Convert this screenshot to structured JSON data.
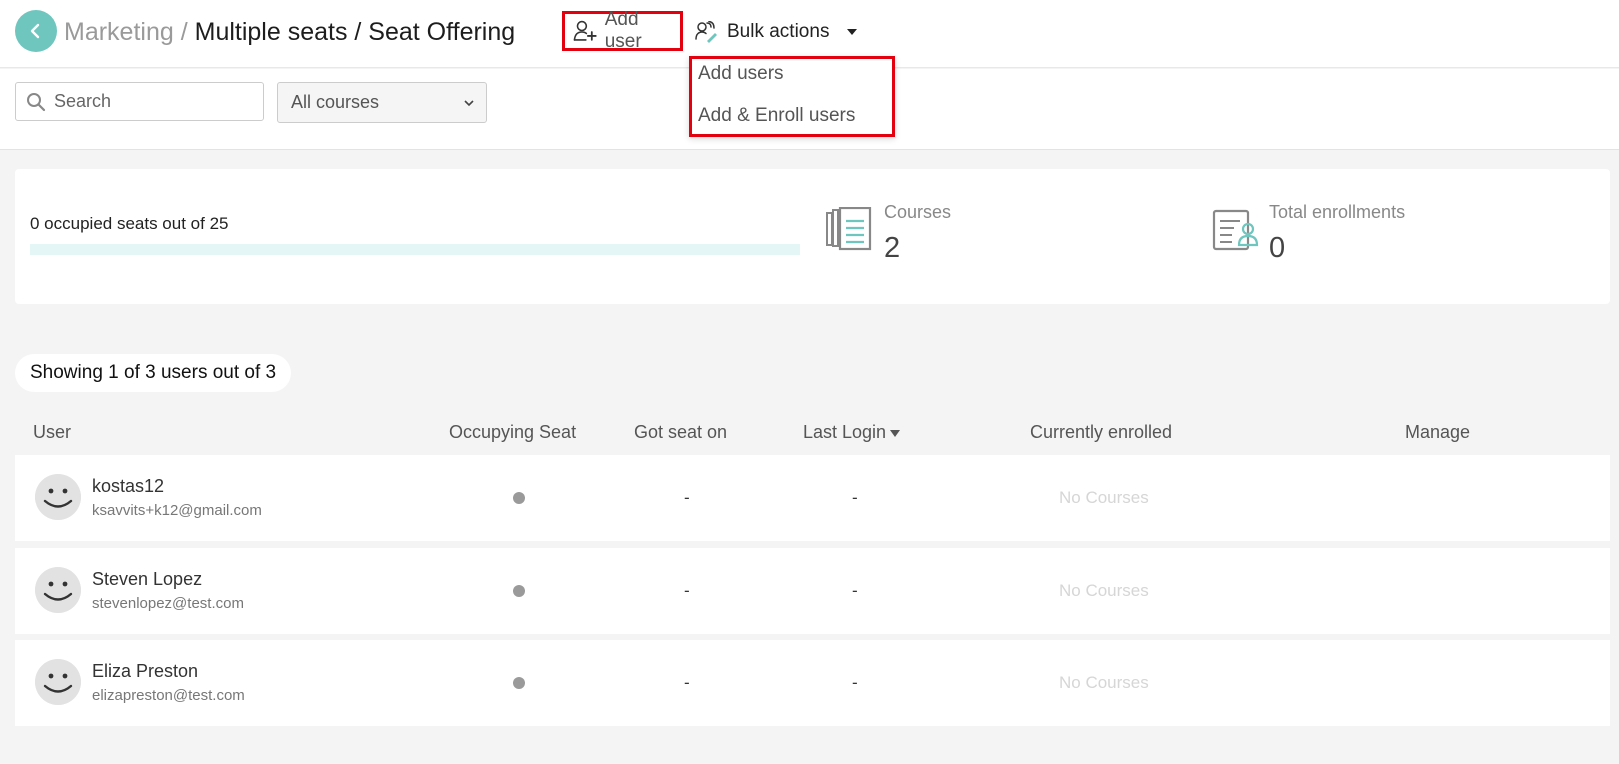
{
  "breadcrumb": {
    "root": "Marketing",
    "separator": "/",
    "current": "Multiple seats / Seat Offering"
  },
  "toolbar": {
    "add_user_label": "Add user",
    "bulk_actions_label": "Bulk actions"
  },
  "add_user_menu": {
    "items": [
      "Add users",
      "Add & Enroll users"
    ]
  },
  "filters": {
    "search_placeholder": "Search",
    "course_select_value": "All courses"
  },
  "stats": {
    "seats_text": "0 occupied seats out of 25",
    "seats_fraction": 0,
    "courses_label": "Courses",
    "courses_value": "2",
    "enrollments_label": "Total enrollments",
    "enrollments_value": "0"
  },
  "showing_text": "Showing 1 of 3 users out of 3",
  "table": {
    "columns": [
      "User",
      "Occupying Seat",
      "Got seat on",
      "Last Login",
      "Currently enrolled",
      "Manage"
    ],
    "rows": [
      {
        "name": "kostas12",
        "email": "ksavvits+k12@gmail.com",
        "got_seat_on": "-",
        "last_login": "-",
        "enrolled": "No Courses"
      },
      {
        "name": "Steven Lopez",
        "email": "stevenlopez@test.com",
        "got_seat_on": "-",
        "last_login": "-",
        "enrolled": "No Courses"
      },
      {
        "name": "Eliza Preston",
        "email": "elizapreston@test.com",
        "got_seat_on": "-",
        "last_login": "-",
        "enrolled": "No Courses"
      }
    ]
  },
  "colors": {
    "accent": "#6ec6bf",
    "highlight": "#e3000f",
    "page_bg": "#f4f4f4"
  },
  "icons": [
    "back-arrow-icon",
    "add-user-icon",
    "bulk-actions-icon",
    "search-icon",
    "courses-icon",
    "enrollments-icon",
    "avatar-smiley-icon"
  ]
}
